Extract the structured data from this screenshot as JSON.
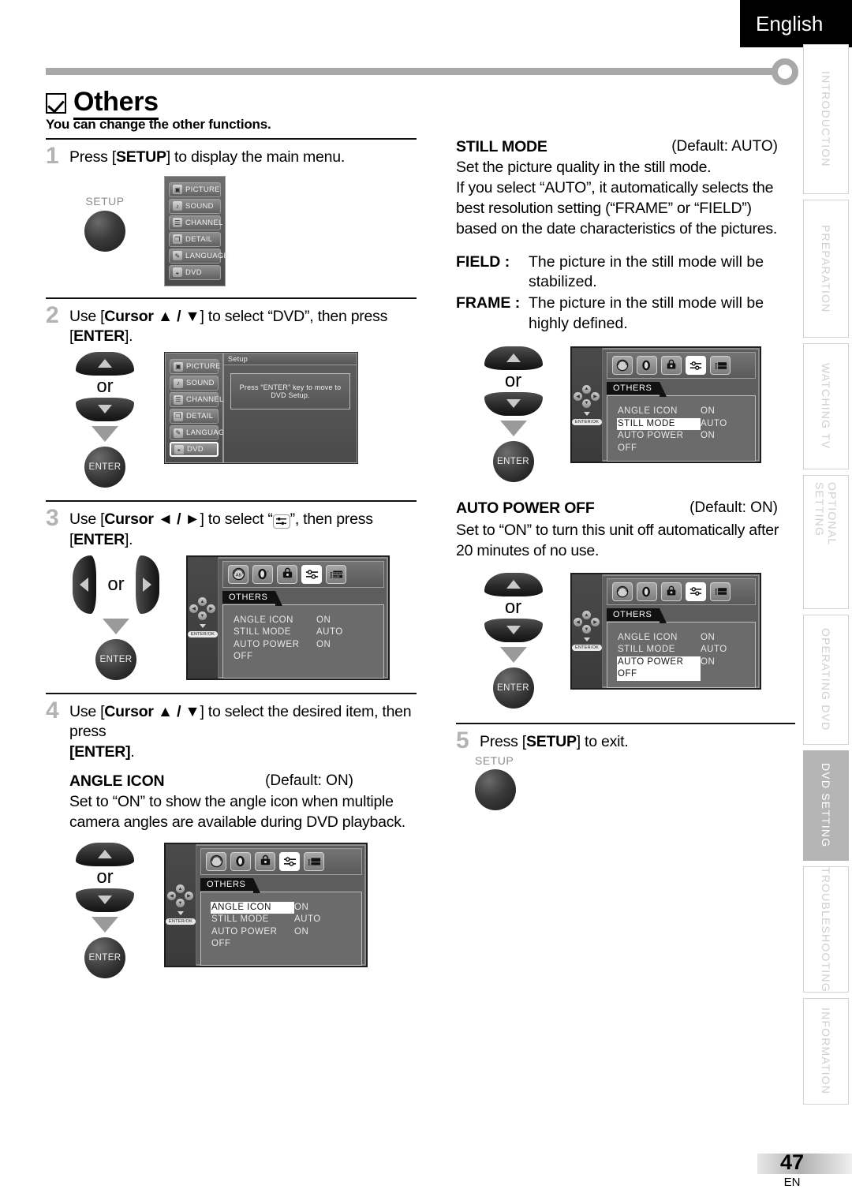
{
  "header": {
    "language": "English"
  },
  "page": {
    "title": "Others",
    "subtitle": "You can change the other functions.",
    "number": "47",
    "lang_code": "EN"
  },
  "side_tabs": [
    {
      "label": "INTRODUCTION",
      "active": false
    },
    {
      "label": "PREPARATION",
      "active": false
    },
    {
      "label": "WATCHING TV",
      "active": false
    },
    {
      "label": "OPTIONAL SETTING",
      "active": false
    },
    {
      "label": "OPERATING DVD",
      "active": false
    },
    {
      "label": "DVD SETTING",
      "active": true
    },
    {
      "label": "TROUBLESHOOTING",
      "active": false
    },
    {
      "label": "INFORMATION",
      "active": false
    }
  ],
  "steps": {
    "s1": {
      "num": "1",
      "text_a": "Press [",
      "bold": "SETUP",
      "text_b": "] to display the main menu."
    },
    "s2": {
      "num": "2",
      "a": "Use [",
      "b1": "Cursor ▲ / ▼",
      "c": "] to select “DVD”, then press [",
      "b2": "ENTER",
      "d": "]."
    },
    "s3": {
      "num": "3",
      "a": "Use [",
      "b1": "Cursor ◄ / ►",
      "c": "] to select “",
      "c2": "”, then press [",
      "b2": "ENTER",
      "d": "]."
    },
    "s4": {
      "num": "4",
      "a": "Use [",
      "b1": "Cursor ▲ / ▼",
      "c": "] to select the desired item, then press",
      "b2": "[ENTER]",
      "d": "."
    },
    "s5": {
      "num": "5",
      "a": "Press [",
      "b": "SETUP",
      "c": "] to exit."
    }
  },
  "keys": {
    "setup_label": "SETUP",
    "enter_label": "ENTER",
    "or_label": "or",
    "enter_ok_label": "ENTER/OK"
  },
  "main_menu": {
    "items": [
      {
        "label": "PICTURE",
        "icon": "picture-icon",
        "selected": false
      },
      {
        "label": "SOUND",
        "icon": "music-note-icon",
        "selected": false
      },
      {
        "label": "CHANNEL",
        "icon": "list-icon",
        "selected": false
      },
      {
        "label": "DETAIL",
        "icon": "layers-icon",
        "selected": false
      },
      {
        "label": "LANGUAGE",
        "icon": "pencil-icon",
        "selected": false
      },
      {
        "label": "DVD",
        "icon": "disc-icon",
        "selected": false
      }
    ],
    "items_step2": [
      {
        "label": "PICTURE",
        "icon": "picture-icon",
        "selected": false
      },
      {
        "label": "SOUND",
        "icon": "music-note-icon",
        "selected": false
      },
      {
        "label": "CHANNEL",
        "icon": "list-icon",
        "selected": false
      },
      {
        "label": "DETAIL",
        "icon": "layers-icon",
        "selected": false
      },
      {
        "label": "LANGUAGE",
        "icon": "pencil-icon",
        "selected": false
      },
      {
        "label": "DVD",
        "icon": "disc-icon",
        "selected": true
      }
    ],
    "setup_pane_title": "Setup",
    "setup_pane_message": "Press “ENTER” key to move to DVD Setup."
  },
  "osd": {
    "tab_icons": [
      {
        "name": "disc-language-icon",
        "active": false
      },
      {
        "name": "audio-icon",
        "active": false
      },
      {
        "name": "parental-lock-icon",
        "active": false
      },
      {
        "name": "others-sliders-icon",
        "active": true
      },
      {
        "name": "initialize-icon",
        "active": false
      }
    ],
    "tab_title": "OTHERS",
    "rows": [
      {
        "name": "ANGLE ICON",
        "value": "ON"
      },
      {
        "name": "STILL MODE",
        "value": "AUTO"
      },
      {
        "name": "AUTO POWER OFF",
        "value": "ON"
      }
    ],
    "highlight_step3": -1,
    "highlight_angle": 0,
    "highlight_still": 1,
    "highlight_power": 2
  },
  "settings": {
    "angle_icon": {
      "name": "ANGLE ICON",
      "default": "(Default: ON)",
      "desc": "Set to “ON” to show the angle icon when multiple camera angles are available during DVD playback."
    },
    "still_mode": {
      "name": "STILL MODE",
      "default": "(Default: AUTO)",
      "desc_1": "Set the picture quality in the still mode.",
      "desc_2": "If you select “AUTO”, it automatically selects the best resolution setting (“FRAME” or “FIELD”) based on the date characteristics of the pictures.",
      "field_label": "FIELD :",
      "field_desc": "The picture in the still mode will be stabilized.",
      "frame_label": "FRAME :",
      "frame_desc": "The picture in the still mode will be highly defined."
    },
    "auto_power_off": {
      "name": "AUTO POWER OFF",
      "default": "(Default: ON)",
      "desc": "Set to “ON” to turn this unit off automatically after 20 minutes of no use."
    }
  }
}
